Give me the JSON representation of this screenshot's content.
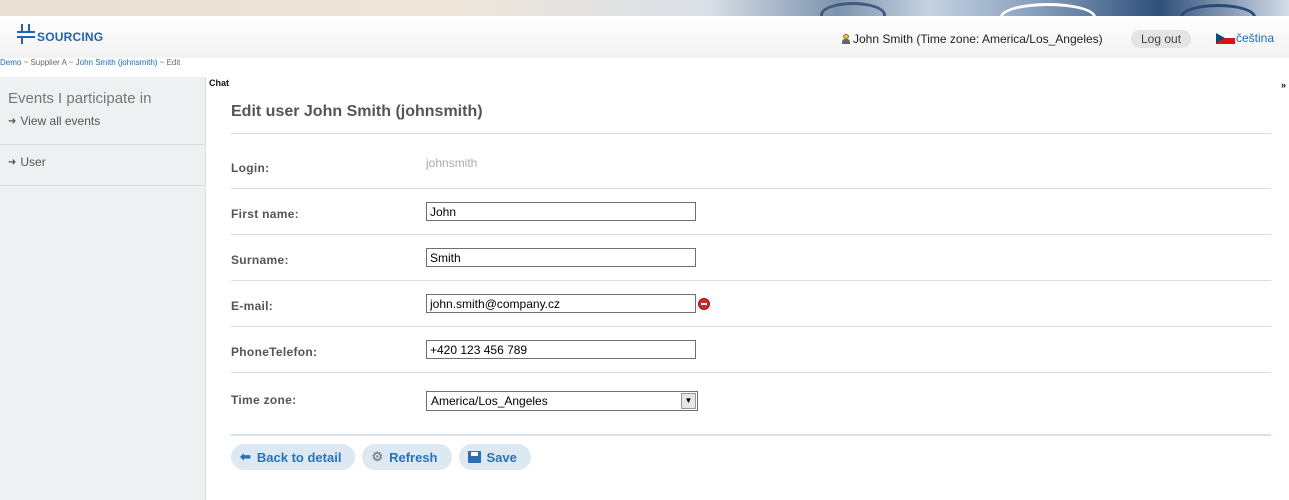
{
  "header": {
    "logo_text": "SOURCING",
    "user_text": "John Smith (Time zone: America/Los_Angeles)",
    "logout_label": "Log out",
    "language_label": "čeština"
  },
  "breadcrumb": {
    "part1": "Demo",
    "sep1": " ~ ",
    "part2": "Supplier A",
    "sep2": " ~ ",
    "part3": "John Smith (johnsmith)",
    "sep3": " ~ ",
    "part4": "Edit"
  },
  "sidebar": {
    "section_title": "Events I participate in",
    "view_all_label": "View all events",
    "user_label": "User"
  },
  "chat": {
    "label": "Chat",
    "toggle": "»"
  },
  "form": {
    "title": "Edit user John Smith (johnsmith)",
    "login_label": "Login:",
    "login_value": "johnsmith",
    "first_name_label": "First name:",
    "first_name_value": "John",
    "surname_label": "Surname:",
    "surname_value": "Smith",
    "email_label": "E-mail:",
    "email_value": "john.smith@company.cz",
    "phone_label": "PhoneTelefon:",
    "phone_value": "+420 123 456 789",
    "timezone_label": "Time zone:",
    "timezone_value": "America/Los_Angeles"
  },
  "actions": {
    "back_label": "Back to detail",
    "refresh_label": "Refresh",
    "save_label": "Save"
  },
  "colors": {
    "brand": "#1f63b4",
    "button_bg": "#dce9f3",
    "button_text": "#2a72b8",
    "error": "#d52a2a"
  }
}
